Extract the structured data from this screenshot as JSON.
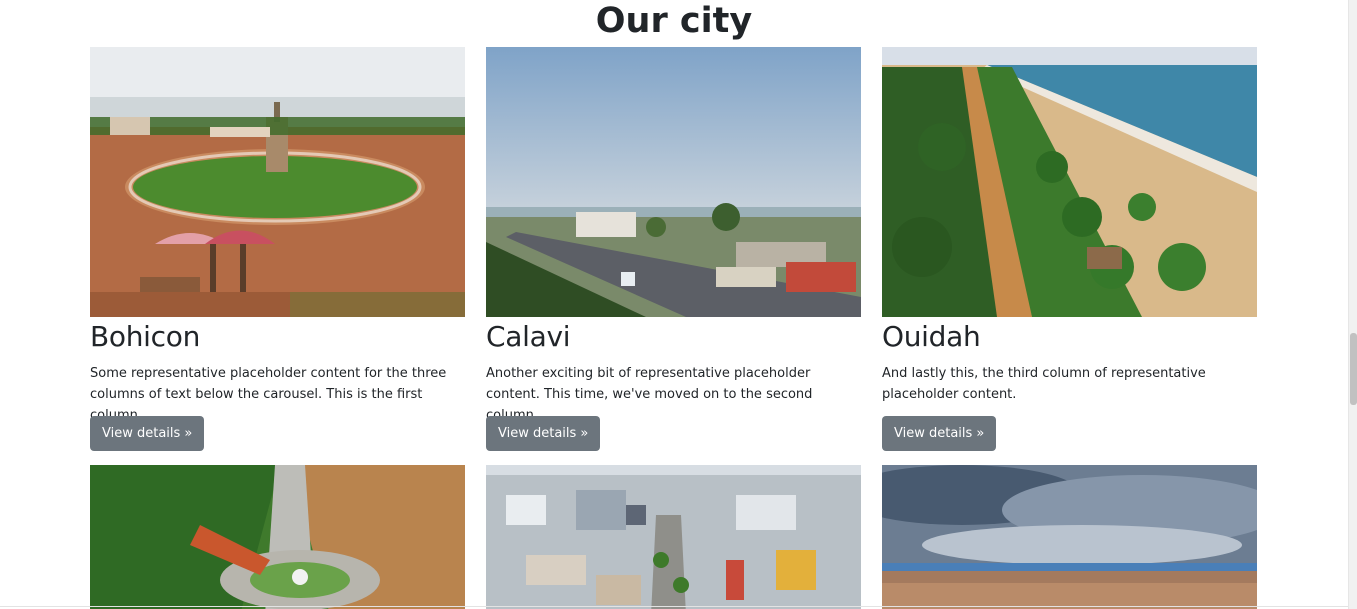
{
  "section": {
    "title": "Our city"
  },
  "cities": [
    {
      "name": "Bohicon",
      "description": "Some representative placeholder content for the three columns of text below the carousel. This is the first column.",
      "button": "View details »"
    },
    {
      "name": "Calavi",
      "description": "Another exciting bit of representative placeholder content. This time, we've moved on to the second column.",
      "button": "View details »"
    },
    {
      "name": "Ouidah",
      "description": "And lastly this, the third column of representative placeholder content.",
      "button": "View details »"
    }
  ],
  "colors": {
    "button_bg": "#6c757d",
    "button_text": "#ffffff",
    "heading": "#212529"
  }
}
